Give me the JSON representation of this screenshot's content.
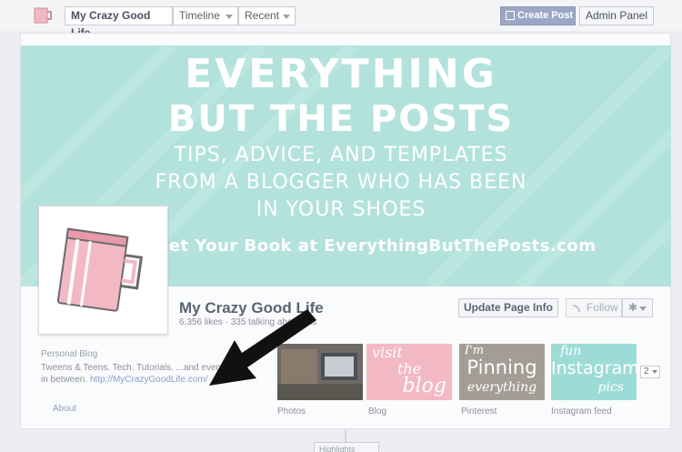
{
  "topbar": {
    "page_name": "My Crazy Good Life",
    "timeline_label": "Timeline",
    "recent_label": "Recent",
    "create_post_label": "Create Post",
    "admin_panel_label": "Admin Panel"
  },
  "cover": {
    "line1": "EVERYTHING",
    "line2": "BUT THE POSTS",
    "line3": "TIPS, ADVICE, AND TEMPLATES",
    "line4": "FROM A BLOGGER WHO HAS BEEN",
    "line5": "IN YOUR SHOES",
    "line6": "Get Your Book at EverythingButThePosts.com",
    "bg_color": "#b3e2dc"
  },
  "profile": {
    "name": "My Crazy Good Life",
    "stats": "6,356 likes · 335 talking about this",
    "update_label": "Update Page Info",
    "follow_label": "Follow"
  },
  "about": {
    "category": "Personal Blog",
    "description": "Tweens & Teens. Tech. Tutorials. ...and everything in between.",
    "url": "http://MyCrazyGoodLife.com/",
    "label": "About"
  },
  "apps": {
    "photos_label": "Photos",
    "blog_label": "Blog",
    "blog_tile_line1": "visit",
    "blog_tile_line2": "the",
    "blog_tile_line3": "blog",
    "pinterest_label": "Pinterest",
    "pin_tile_line1": "I'm",
    "pin_tile_line2": "Pinning",
    "pin_tile_line3": "everything",
    "instagram_label": "Instagram feed",
    "insta_tile_line1": "fun",
    "insta_tile_line2": "Instagram",
    "insta_tile_line3": "pics",
    "more_count": "2"
  },
  "timeline": {
    "highlights_label": "Highlights"
  }
}
